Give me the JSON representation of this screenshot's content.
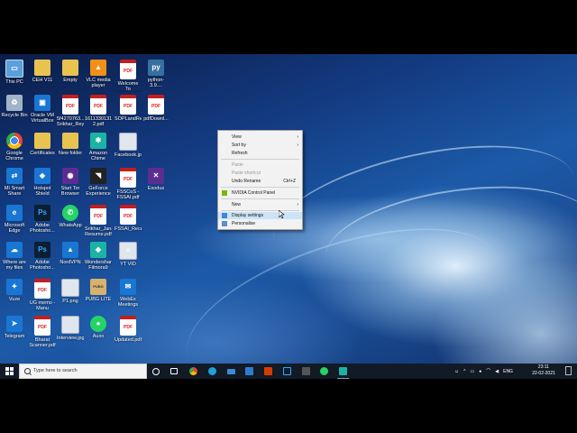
{
  "desktop_icons": [
    {
      "label": "This PC",
      "icon": "this-pc-icon",
      "glyph": "▭",
      "style": "g-monitor"
    },
    {
      "label": "CEH V11",
      "icon": "folder-icon",
      "glyph": "",
      "style": "g-folder"
    },
    {
      "label": "Empty",
      "icon": "folder-icon",
      "glyph": "",
      "style": "g-folder"
    },
    {
      "label": "VLC media player",
      "icon": "vlc-icon",
      "glyph": "▲",
      "style": "g-orange"
    },
    {
      "label": "Welcome To TRANSPORT...",
      "icon": "pdf-file-icon",
      "glyph": "PDF",
      "style": "g-pdf"
    },
    {
      "label": "python-3.9....",
      "icon": "python-icon",
      "glyph": "py",
      "style": "g-py"
    },
    {
      "label": "Recycle Bin",
      "icon": "recycle-bin-icon",
      "glyph": "♻",
      "style": "g-bin"
    },
    {
      "label": "Oracle VM VirtualBox",
      "icon": "virtualbox-icon",
      "glyph": "▣",
      "style": "g-blue"
    },
    {
      "label": "5f4270763... Srikhar_Rey...",
      "icon": "pdf-file-icon",
      "glyph": "PDF",
      "style": "g-pdf"
    },
    {
      "label": "1611330131... 2.pdf",
      "icon": "pdf-file-icon",
      "glyph": "PDF",
      "style": "g-pdf"
    },
    {
      "label": "SOPLandRe...",
      "icon": "pdf-file-icon",
      "glyph": "PDF",
      "style": "g-pdf"
    },
    {
      "label": "pdfDownl...",
      "icon": "pdf-file-icon",
      "glyph": "PDF",
      "style": "g-pdf"
    },
    {
      "label": "Google Chrome",
      "icon": "chrome-icon",
      "glyph": "",
      "style": "g-chrome"
    },
    {
      "label": "Certificates",
      "icon": "folder-icon",
      "glyph": "",
      "style": "g-folder"
    },
    {
      "label": "New folder",
      "icon": "folder-icon",
      "glyph": "",
      "style": "g-folder"
    },
    {
      "label": "Amazon Chime",
      "icon": "amazon-chime-icon",
      "glyph": "✱",
      "style": "g-teal"
    },
    {
      "label": "Facebook.jpg",
      "icon": "image-file-icon",
      "glyph": "",
      "style": "g-img"
    },
    {
      "label": "MI Smart Share",
      "icon": "mi-share-icon",
      "glyph": "⇄",
      "style": "g-blue"
    },
    {
      "label": "Hotspot Shield",
      "icon": "hotspot-shield-icon",
      "glyph": "◆",
      "style": "g-blue"
    },
    {
      "label": "Start Tor Browser",
      "icon": "tor-icon",
      "glyph": "◉",
      "style": "g-purple"
    },
    {
      "label": "GeForce Experience",
      "icon": "geforce-icon",
      "glyph": "◥",
      "style": "g-dark"
    },
    {
      "label": "FSSCoS - FSSAI.pdf",
      "icon": "pdf-file-icon",
      "glyph": "PDF",
      "style": "g-pdf"
    },
    {
      "label": "Exodus",
      "icon": "exodus-icon",
      "glyph": "✕",
      "style": "g-purple"
    },
    {
      "label": "Microsoft Edge",
      "icon": "edge-icon",
      "glyph": "e",
      "style": "g-blue"
    },
    {
      "label": "Adobe Photosho...",
      "icon": "photoshop-icon",
      "glyph": "Ps",
      "style": "g-ps"
    },
    {
      "label": "WhatsApp",
      "icon": "whatsapp-icon",
      "glyph": "✆",
      "style": "g-green"
    },
    {
      "label": "Srikhar_Jana Resume.pdf",
      "icon": "pdf-file-icon",
      "glyph": "PDF",
      "style": "g-pdf"
    },
    {
      "label": "FSSAI_Recei...",
      "icon": "pdf-file-icon",
      "glyph": "PDF",
      "style": "g-pdf"
    },
    {
      "label": "Where are my files",
      "icon": "onedrive-icon",
      "glyph": "☁",
      "style": "g-blue"
    },
    {
      "label": "Adobe Photosho...",
      "icon": "photoshop-icon",
      "glyph": "Ps",
      "style": "g-ps"
    },
    {
      "label": "NordVPN",
      "icon": "nordvpn-icon",
      "glyph": "▲",
      "style": "g-blue"
    },
    {
      "label": "Wondershare Filmora9",
      "icon": "filmora-icon",
      "glyph": "◆",
      "style": "g-teal"
    },
    {
      "label": "YT VID",
      "icon": "text-file-icon",
      "glyph": "≡",
      "style": "g-img"
    },
    {
      "label": "Vuze",
      "icon": "vuze-icon",
      "glyph": "✦",
      "style": "g-blue"
    },
    {
      "label": "UG memo - Manu Prava...",
      "icon": "pdf-file-icon",
      "glyph": "PDF",
      "style": "g-pdf"
    },
    {
      "label": "P1.png",
      "icon": "image-file-icon",
      "glyph": "",
      "style": "g-img"
    },
    {
      "label": "PUBG LITE",
      "icon": "pubg-icon",
      "glyph": "PUBG",
      "style": "g-pubg"
    },
    {
      "label": "WebEx Meetings",
      "icon": "webex-icon",
      "glyph": "✉",
      "style": "g-blue"
    },
    {
      "label": "Telegram",
      "icon": "telegram-icon",
      "glyph": "➤",
      "style": "g-blue"
    },
    {
      "label": "Bharat Scanner.pdf",
      "icon": "pdf-file-icon",
      "glyph": "PDF",
      "style": "g-pdf"
    },
    {
      "label": "Interview.jpg",
      "icon": "image-file-icon",
      "glyph": "",
      "style": "g-img"
    },
    {
      "label": "Auxo",
      "icon": "auxo-icon",
      "glyph": "●",
      "style": "g-green"
    },
    {
      "label": "Updated.pdf",
      "icon": "pdf-file-icon",
      "glyph": "PDF",
      "style": "g-pdf"
    }
  ],
  "context_menu": {
    "view": "View",
    "sort_by": "Sort by",
    "refresh": "Refresh",
    "paste": "Paste",
    "paste_shortcut": "Paste shortcut",
    "undo_rename": "Undo Rename",
    "undo_shortcut": "Ctrl+Z",
    "nvidia": "NVIDIA Control Panel",
    "new": "New",
    "display_settings": "Display settings",
    "personalise": "Personalise"
  },
  "taskbar": {
    "search_placeholder": "Type here to search",
    "language": "ENG",
    "time": "23:11",
    "date": "22-02-2021"
  },
  "colors": {
    "taskbar": "#121a26",
    "menu_bg": "#f2f2f2",
    "menu_highlight": "#cce4f7"
  }
}
